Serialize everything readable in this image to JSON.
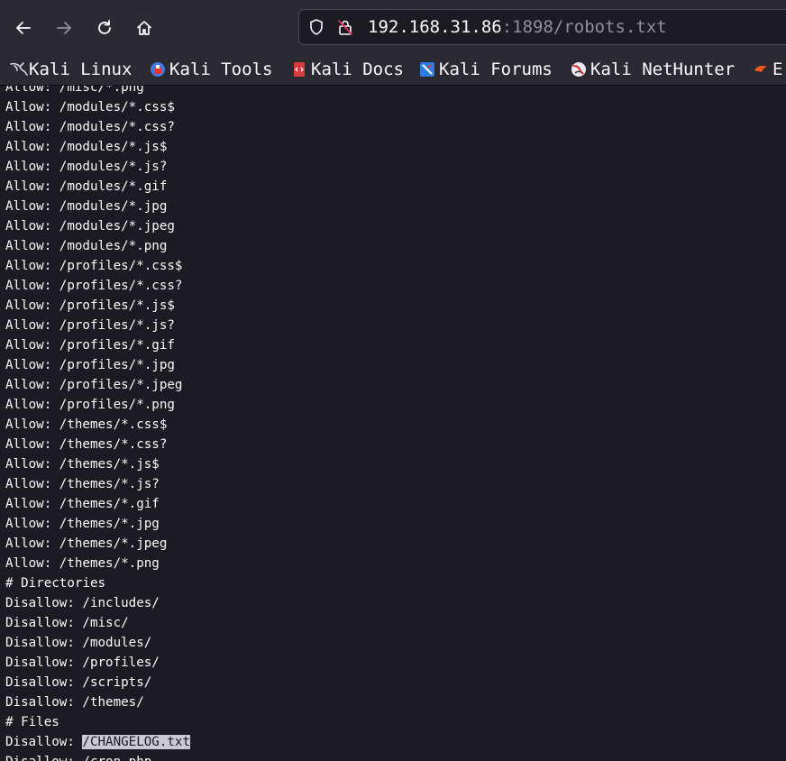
{
  "toolbar": {
    "back_icon": "arrow-left-icon",
    "forward_icon": "arrow-right-icon",
    "reload_icon": "reload-icon",
    "home_icon": "home-icon"
  },
  "urlbar": {
    "host": "192.168.31.86",
    "rest": ":1898/robots.txt"
  },
  "bookmarks": [
    {
      "label": "Kali Linux",
      "icon": "kali-dragon-icon"
    },
    {
      "label": "Kali Tools",
      "icon": "kali-tools-icon"
    },
    {
      "label": "Kali Docs",
      "icon": "kali-docs-icon"
    },
    {
      "label": "Kali Forums",
      "icon": "kali-forums-icon"
    },
    {
      "label": "Kali NetHunter",
      "icon": "kali-nethunter-icon"
    },
    {
      "label": "E",
      "icon": "exploit-db-icon"
    }
  ],
  "content": {
    "lines": [
      "Allow: /misc/*.png",
      "Allow: /modules/*.css$",
      "Allow: /modules/*.css?",
      "Allow: /modules/*.js$",
      "Allow: /modules/*.js?",
      "Allow: /modules/*.gif",
      "Allow: /modules/*.jpg",
      "Allow: /modules/*.jpeg",
      "Allow: /modules/*.png",
      "Allow: /profiles/*.css$",
      "Allow: /profiles/*.css?",
      "Allow: /profiles/*.js$",
      "Allow: /profiles/*.js?",
      "Allow: /profiles/*.gif",
      "Allow: /profiles/*.jpg",
      "Allow: /profiles/*.jpeg",
      "Allow: /profiles/*.png",
      "Allow: /themes/*.css$",
      "Allow: /themes/*.css?",
      "Allow: /themes/*.js$",
      "Allow: /themes/*.js?",
      "Allow: /themes/*.gif",
      "Allow: /themes/*.jpg",
      "Allow: /themes/*.jpeg",
      "Allow: /themes/*.png",
      "# Directories",
      "Disallow: /includes/",
      "Disallow: /misc/",
      "Disallow: /modules/",
      "Disallow: /profiles/",
      "Disallow: /scripts/",
      "Disallow: /themes/",
      "# Files"
    ],
    "selected_line": {
      "prefix": "Disallow: ",
      "selected": "/CHANGELOG.txt"
    },
    "last_line": "Disallow: /cron.php"
  }
}
